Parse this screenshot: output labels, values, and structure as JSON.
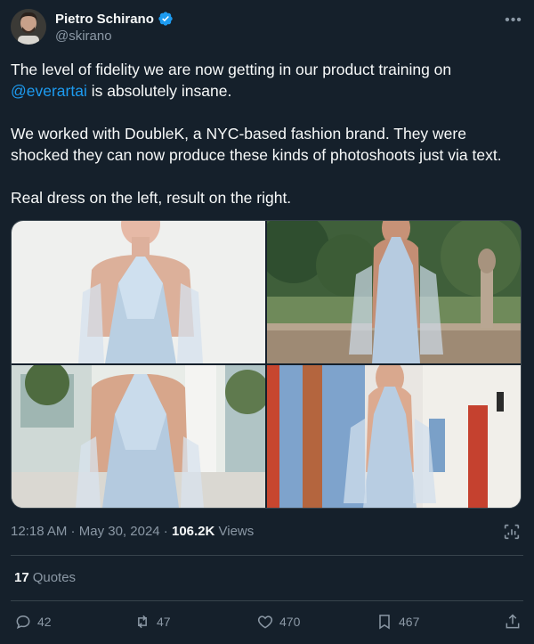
{
  "author": {
    "name": "Pietro Schirano",
    "handle": "@skirano",
    "verified": true
  },
  "tweet": {
    "line1_before": "The level of fidelity we are now getting in our product training on",
    "mention": "@everartai",
    "line2_after": " is absolutely insane.",
    "paragraph2": "We worked with DoubleK, a NYC-based fashion brand. They were shocked they can now produce these kinds of photoshoots just via text.",
    "paragraph3": "Real dress on the left, result on the right."
  },
  "meta": {
    "time": "12:18 AM",
    "separator": " · ",
    "date": "May 30, 2024",
    "views_count": "106.2K",
    "views_label": " Views"
  },
  "quotes": {
    "count": "17",
    "label": "Quotes"
  },
  "actions": {
    "replies": "42",
    "reposts": "47",
    "likes": "470",
    "bookmarks": "467"
  },
  "colors": {
    "background": "#15202b",
    "accent": "#1d9bf0",
    "muted": "#8b98a5",
    "border": "#38444d"
  }
}
